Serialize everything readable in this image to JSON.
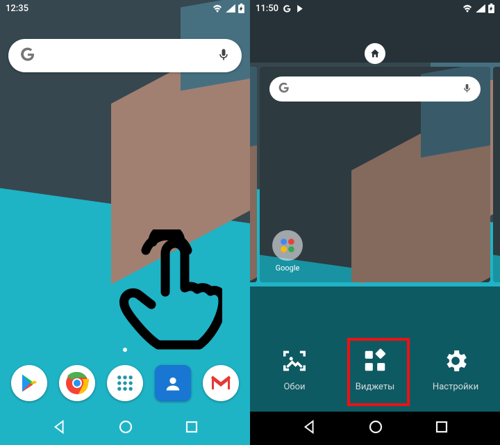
{
  "left": {
    "status": {
      "time": "12:35"
    },
    "dock": {
      "apps": [
        {
          "name": "play-store"
        },
        {
          "name": "chrome"
        },
        {
          "name": "app-drawer"
        },
        {
          "name": "contacts"
        },
        {
          "name": "gmail"
        }
      ]
    }
  },
  "right": {
    "status": {
      "time": "11:50"
    },
    "preview": {
      "folder_label": "Google"
    },
    "panel": {
      "items": [
        {
          "key": "wallpapers",
          "label": "Обои"
        },
        {
          "key": "widgets",
          "label": "Виджеты"
        },
        {
          "key": "settings",
          "label": "Настройки"
        }
      ],
      "highlighted": "widgets"
    }
  },
  "icons": {
    "google_g": "G",
    "mic": "mic-icon",
    "wifi": "wifi-icon",
    "signal": "signal-icon",
    "battery": "battery-icon",
    "nav_back": "back-icon",
    "nav_home": "home-icon",
    "nav_recent": "recent-icon"
  }
}
